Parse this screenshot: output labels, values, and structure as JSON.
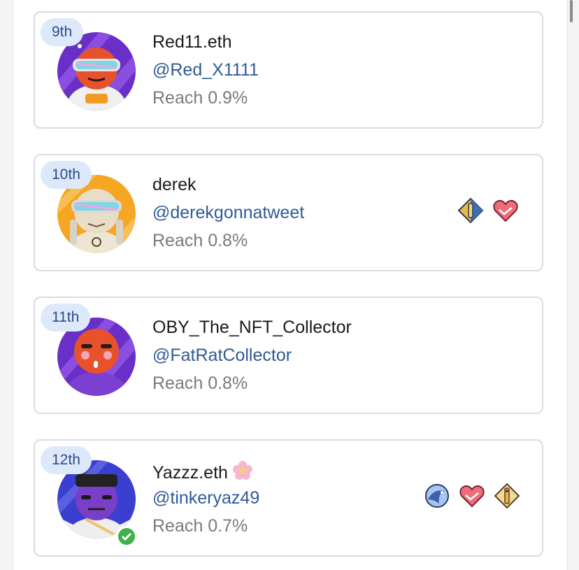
{
  "leaderboard": {
    "entries": [
      {
        "rank": "9th",
        "name": "Red11.eth",
        "handle": "@Red_X1111",
        "reach": "Reach 0.9%",
        "avatar": "astronaut-red-avatar",
        "badges": []
      },
      {
        "rank": "10th",
        "name": "derek",
        "handle": "@derekgonnatweet",
        "reach": "Reach 0.8%",
        "avatar": "astronaut-beige-avatar",
        "badges": [
          "key-badge-icon",
          "handshake-badge-icon"
        ]
      },
      {
        "rank": "11th",
        "name": "OBY_The_NFT_Collector",
        "handle": "@FatRatCollector",
        "reach": "Reach 0.8%",
        "avatar": "astronaut-orange-avatar",
        "badges": []
      },
      {
        "rank": "12th",
        "name": "Yazzz.eth",
        "handle": "@tinkeryaz49",
        "reach": "Reach 0.7%",
        "avatar": "astronaut-purple-avatar",
        "verified": true,
        "name_emoji": "cherry-blossom-icon",
        "badges": [
          "dolphin-badge-icon",
          "handshake-badge-icon",
          "key-badge-icon"
        ]
      }
    ]
  },
  "colors": {
    "rank_pill_bg": "#dde9fb",
    "rank_text": "#2a4d8a",
    "handle": "#2f5a96",
    "reach_text": "#7a7a7a",
    "card_border": "#d9dce1",
    "verified": "#3fb04a"
  }
}
